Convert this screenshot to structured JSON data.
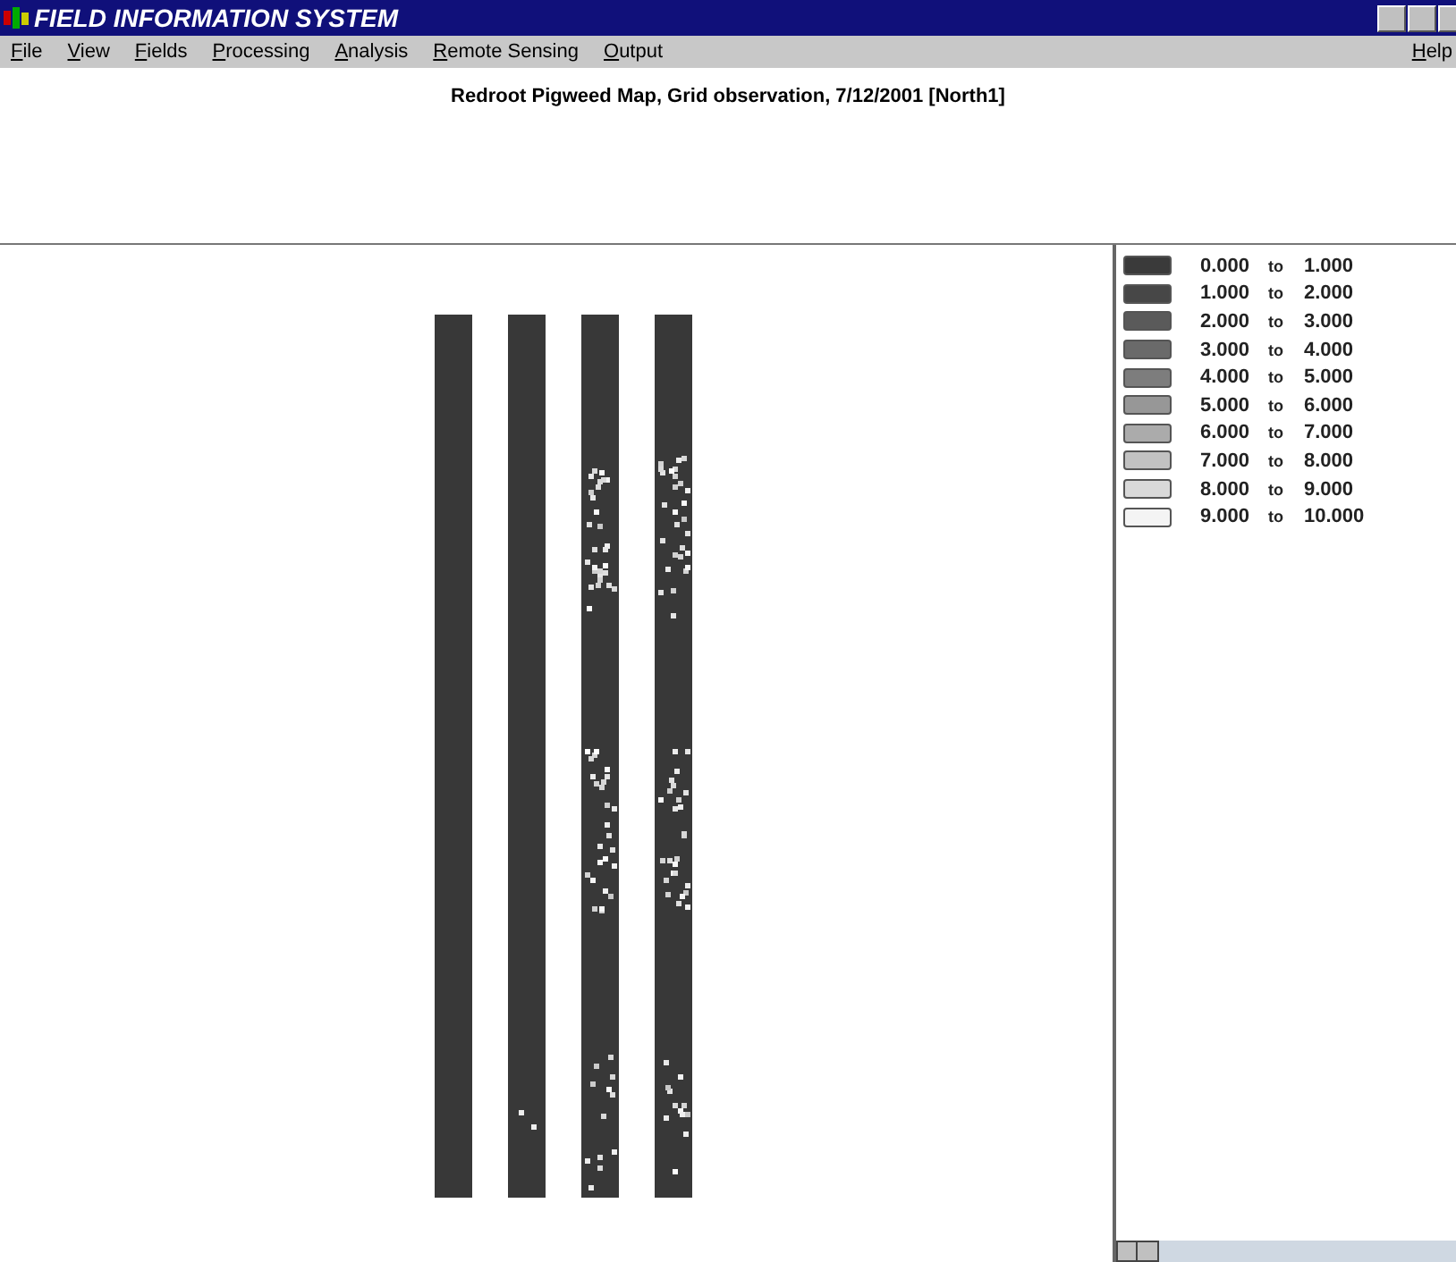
{
  "window": {
    "title": "FIELD INFORMATION SYSTEM"
  },
  "menu": {
    "items": [
      {
        "label": "File"
      },
      {
        "label": "View"
      },
      {
        "label": "Fields"
      },
      {
        "label": "Processing"
      },
      {
        "label": "Analysis"
      },
      {
        "label": "Remote Sensing"
      },
      {
        "label": "Output"
      }
    ],
    "help": {
      "label": "Help"
    }
  },
  "map_title": "Redroot Pigweed Map, Grid observation, 7/12/2001 [North1]",
  "legend": [
    {
      "from": "0.000",
      "to_word": "to",
      "to": "1.000",
      "color": "#3a3a3a"
    },
    {
      "from": "1.000",
      "to_word": "to",
      "to": "2.000",
      "color": "#474747"
    },
    {
      "from": "2.000",
      "to_word": "to",
      "to": "3.000",
      "color": "#5a5a5a"
    },
    {
      "from": "3.000",
      "to_word": "to",
      "to": "4.000",
      "color": "#6a6a6a"
    },
    {
      "from": "4.000",
      "to_word": "to",
      "to": "5.000",
      "color": "#7d7d7d"
    },
    {
      "from": "5.000",
      "to_word": "to",
      "to": "6.000",
      "color": "#979797"
    },
    {
      "from": "6.000",
      "to_word": "to",
      "to": "7.000",
      "color": "#ababab"
    },
    {
      "from": "7.000",
      "to_word": "to",
      "to": "8.000",
      "color": "#c2c2c2"
    },
    {
      "from": "8.000",
      "to_word": "to",
      "to": "9.000",
      "color": "#d9d9d9"
    },
    {
      "from": "9.000",
      "to_word": "to",
      "to": "10.000",
      "color": "#f4f4f4"
    }
  ]
}
